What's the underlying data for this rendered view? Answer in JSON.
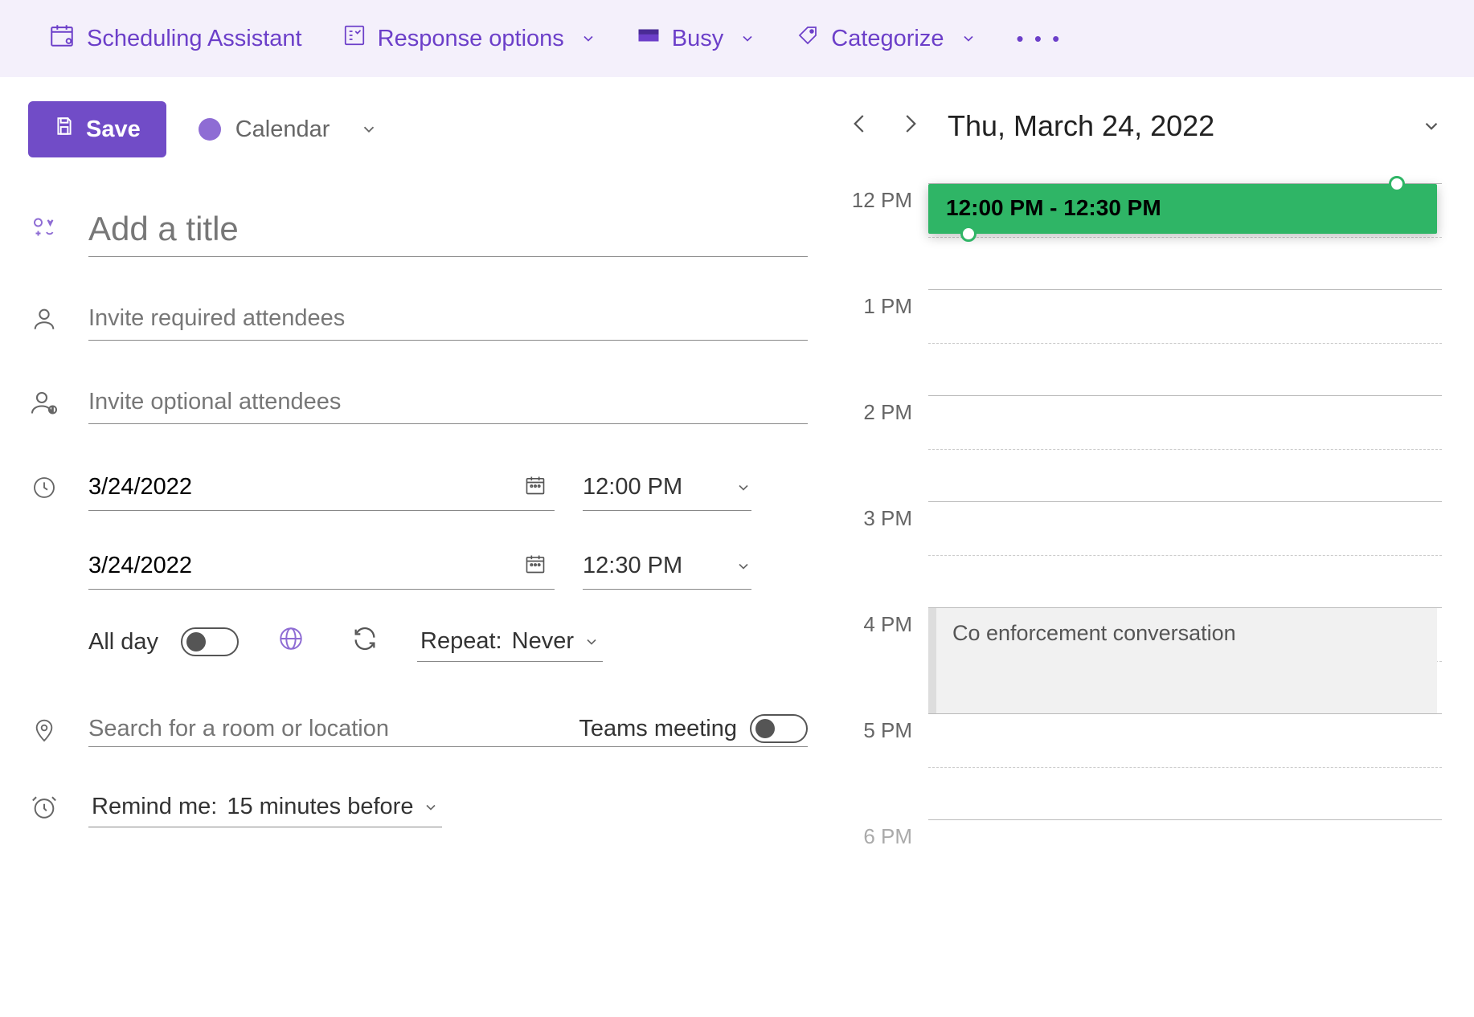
{
  "toolbar": {
    "scheduling_assistant": "Scheduling Assistant",
    "response_options": "Response options",
    "busy": "Busy",
    "categorize": "Categorize"
  },
  "actions": {
    "save_label": "Save",
    "calendar_label": "Calendar"
  },
  "form": {
    "title_placeholder": "Add a title",
    "required_placeholder": "Invite required attendees",
    "optional_placeholder": "Invite optional attendees",
    "start_date": "3/24/2022",
    "start_time": "12:00 PM",
    "end_date": "3/24/2022",
    "end_time": "12:30 PM",
    "all_day_label": "All day",
    "repeat_label": "Repeat:",
    "repeat_value": "Never",
    "location_placeholder": "Search for a room or location",
    "teams_label": "Teams meeting",
    "remind_label": "Remind me:",
    "remind_value": "15 minutes before"
  },
  "preview": {
    "date_display": "Thu, March 24, 2022",
    "hours": [
      "12 PM",
      "1 PM",
      "2 PM",
      "3 PM",
      "4 PM",
      "5 PM",
      "6 PM"
    ],
    "new_event_time": "12:00 PM - 12:30 PM",
    "existing_event": "Co enforcement conversation"
  }
}
